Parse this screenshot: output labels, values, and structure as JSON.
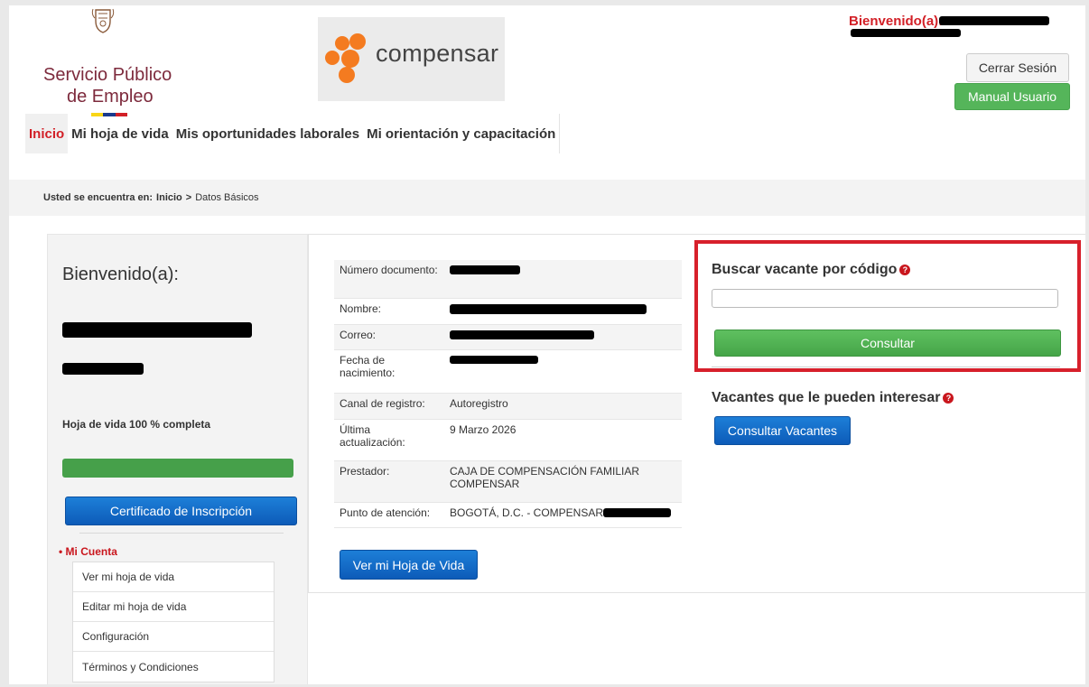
{
  "header": {
    "spe_logo_line1": "Servicio Público",
    "spe_logo_line2": "de Empleo",
    "compensar_logo_text": "compensar",
    "welcome_label": "Bienvenido(a):",
    "logout_label": "Cerrar Sesión",
    "manual_label": "Manual Usuario"
  },
  "nav": {
    "items": [
      {
        "label": "Inicio",
        "active": true
      },
      {
        "label": "Mi hoja de vida",
        "active": false
      },
      {
        "label": "Mis oportunidades laborales",
        "active": false
      },
      {
        "label": "Mi orientación y capacitación",
        "active": false
      }
    ]
  },
  "breadcrumb": {
    "prefix": "Usted se encuentra en:",
    "home": "Inicio",
    "separator": ">",
    "current": "Datos Básicos"
  },
  "sidebar": {
    "title": "Bienvenido(a):",
    "progress_label": "Hoja de vida 100 % completa",
    "progress_value": 100,
    "certificate_label": "Certificado de Inscripción",
    "account_title": "Mi Cuenta",
    "account_items": [
      "Ver mi hoja de vida",
      "Editar mi hoja de vida",
      "Configuración",
      "Términos y Condiciones"
    ]
  },
  "profile": {
    "rows": [
      {
        "label": "Número documento:",
        "value": ""
      },
      {
        "label": "Nombre:",
        "value": ""
      },
      {
        "label": "Correo:",
        "value": ""
      },
      {
        "label": "Fecha de nacimiento:",
        "value": ""
      },
      {
        "label": "Canal de registro:",
        "value": "Autoregistro"
      },
      {
        "label": "Última actualización:",
        "value": "9 Marzo 2026"
      },
      {
        "label": "Prestador:",
        "value": "CAJA DE COMPENSACIÓN FAMILIAR COMPENSAR"
      },
      {
        "label": "Punto de atención:",
        "value": "BOGOTÁ, D.C. - COMPENSAR"
      }
    ],
    "view_cv_label": "Ver mi Hoja de Vida"
  },
  "search": {
    "title": "Buscar vacante por código",
    "input_value": "",
    "button_label": "Consultar"
  },
  "vacancies": {
    "title": "Vacantes que le pueden interesar",
    "button_label": "Consultar Vacantes"
  },
  "colors": {
    "accent_red": "#d21f26",
    "brand_maroon": "#7d2a3c",
    "compensar_orange": "#f47b20",
    "primary_blue": "#0d5bb8",
    "success_green": "#46a04a"
  },
  "icons": {
    "help": "question-circle-icon",
    "shield": "coat-of-arms-icon"
  }
}
